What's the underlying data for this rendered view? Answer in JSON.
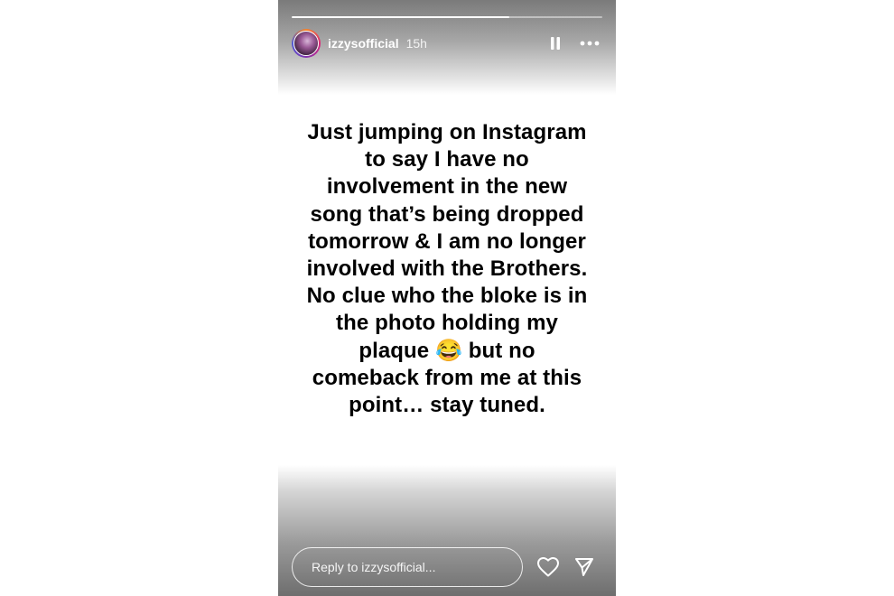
{
  "story": {
    "progress": 0.7,
    "header": {
      "username": "izzysofficial",
      "time": "15h"
    },
    "text": "Just jumping on Instagram to say I have no involvement in the new song that’s being dropped tomorrow & I am no longer involved with the Brothers. No clue who the bloke is in the photo holding my plaque 😂 but no comeback from me at this point… stay tuned.",
    "reply": {
      "placeholder": "Reply to izzysofficial..."
    }
  },
  "icons": {
    "pause": "pause-icon",
    "more": "more-options-icon",
    "heart": "heart-icon",
    "send": "send-icon"
  },
  "colors": {
    "text": "#000000",
    "background": "#ffffff",
    "overlay_text": "#ffffff"
  }
}
